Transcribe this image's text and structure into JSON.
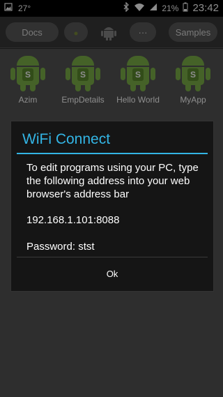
{
  "status_bar": {
    "temperature": "27°",
    "battery": "21%",
    "time": "23:42"
  },
  "toolbar": {
    "docs_label": "Docs",
    "menu_label": "···",
    "samples_label": "Samples"
  },
  "apps": [
    {
      "name": "Azim",
      "badge": "S"
    },
    {
      "name": "EmpDetails",
      "badge": "S"
    },
    {
      "name": "Hello World",
      "badge": "S"
    },
    {
      "name": "MyApp",
      "badge": "S"
    }
  ],
  "dialog": {
    "title": "WiFi Connect",
    "message": "To edit programs using your PC, type the following address into your web browser's address bar",
    "address": "192.168.1.101:8088",
    "password": "Password: stst",
    "ok_label": "Ok"
  },
  "colors": {
    "accent": "#33b5e5",
    "android_green": "#7eb34a"
  }
}
